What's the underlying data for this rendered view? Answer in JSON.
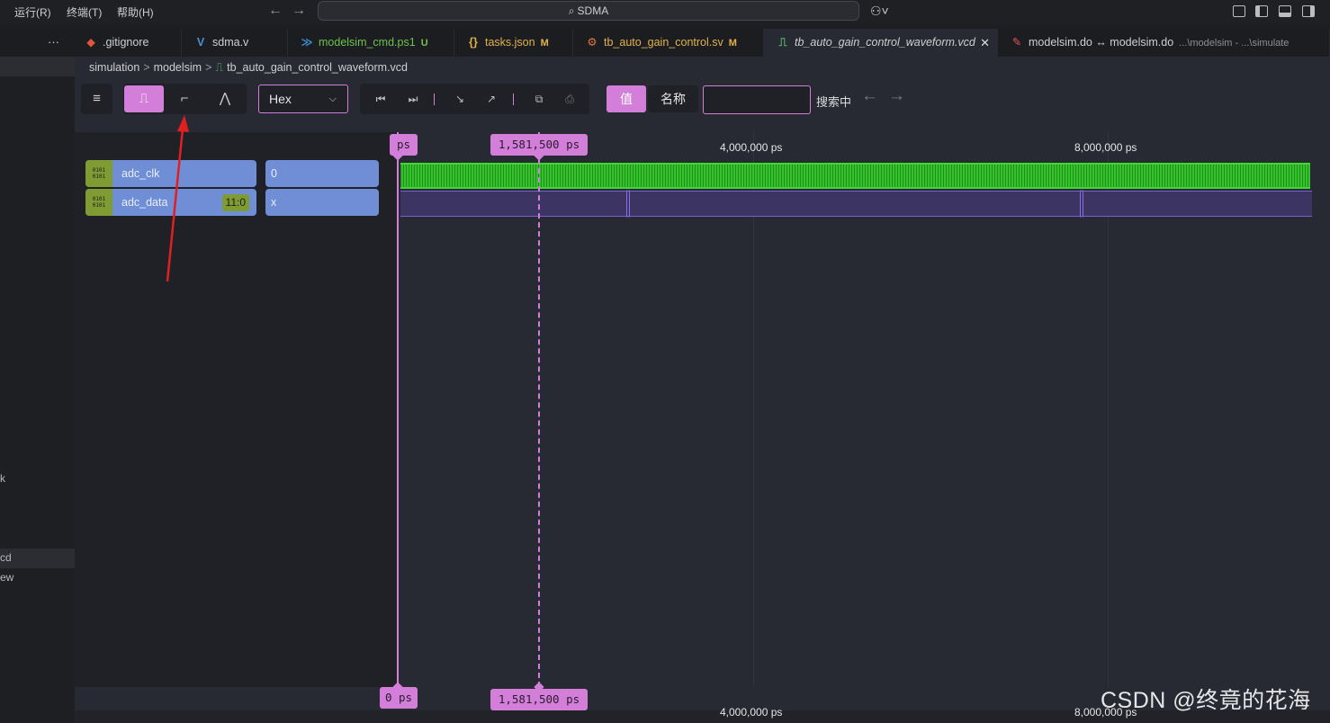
{
  "menu": {
    "run": "运行(R)",
    "terminal": "终端(T)",
    "help": "帮助(H)"
  },
  "title_search": "SDMA",
  "tabs_overflow": "···",
  "tabs": [
    {
      "icon_glyph": "◆",
      "icon_color": "#e2553b",
      "label": ".gitignore",
      "mark": "",
      "label_color": "#cfcfcf"
    },
    {
      "icon_glyph": "V",
      "icon_color": "#4f8fd1",
      "label": "sdma.v",
      "mark": "",
      "label_color": "#cfcfcf"
    },
    {
      "icon_glyph": "≫",
      "icon_color": "#3b8fd6",
      "label": "modelsim_cmd.ps1",
      "mark": "U",
      "label_color": "#6cc24a"
    },
    {
      "icon_glyph": "{}",
      "icon_color": "#e2b24a",
      "label": "tasks.json",
      "mark": "M",
      "label_color": "#e2b24a"
    },
    {
      "icon_glyph": "⚙",
      "icon_color": "#e2763b",
      "label": "tb_auto_gain_control.sv",
      "mark": "M",
      "label_color": "#e2b24a"
    },
    {
      "icon_glyph": "⎍",
      "icon_color": "#58c06a",
      "label": "tb_auto_gain_control_waveform.vcd",
      "mark": "",
      "label_color": "#cfcfcf"
    },
    {
      "icon_glyph": "✎",
      "icon_color": "#e25151",
      "label": "modelsim.do ↔ modelsim.do",
      "mark": "",
      "label_color": "#cfcfcf",
      "dim": "...\\modelsim - ...\\simulate"
    }
  ],
  "sidebar_fragments": [
    "k",
    "cd",
    "ew"
  ],
  "breadcrumb": {
    "part1": "simulation",
    "part2": "modelsim",
    "file": "tb_auto_gain_control_waveform.vcd"
  },
  "toolbar": {
    "radix": "Hex",
    "seg_value": "值",
    "seg_name": "名称",
    "search_placeholder": "",
    "search_status": "搜索中"
  },
  "signals": [
    {
      "name": "adc_clk",
      "width": "",
      "value": "0",
      "bits": "0101\n0101"
    },
    {
      "name": "adc_data",
      "width": "11:0",
      "value": "x",
      "bits": "0101\n0101"
    }
  ],
  "timeline": {
    "ticks": [
      "4,000,000 ps",
      "8,000,000 ps"
    ],
    "origin_marker": "0 ps",
    "origin_marker_top": "ps",
    "cursor_marker": "1,581,500 ps"
  },
  "colors": {
    "accent": "#d37ed9",
    "clock_wave": "#33b62b",
    "data_wave": "#7b5dd6",
    "signal_bg": "#6f8ed6",
    "bit_badge": "#7e9c32",
    "annotation_arrow": "#e02020"
  },
  "watermark": "CSDN @终竟的花海"
}
